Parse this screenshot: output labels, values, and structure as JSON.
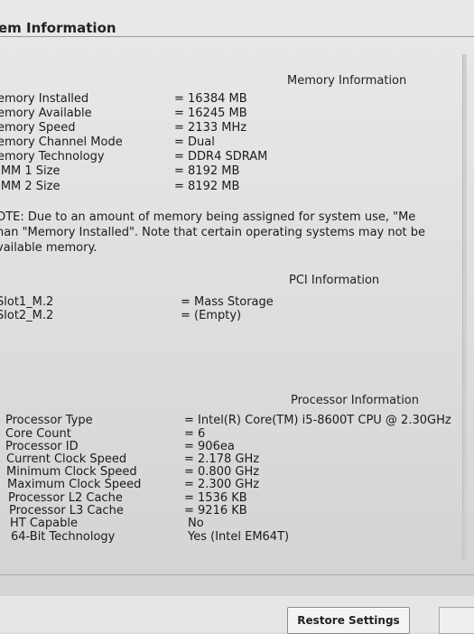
{
  "section_title": "em Information",
  "memory": {
    "header": "Memory Information",
    "rows": [
      {
        "label": "emory Installed",
        "value": "= 16384 MB"
      },
      {
        "label": "emory Available",
        "value": "= 16245 MB"
      },
      {
        "label": "emory Speed",
        "value": "= 2133 MHz"
      },
      {
        "label": "emory Channel Mode",
        "value": "= Dual"
      },
      {
        "label": "emory Technology",
        "value": "= DDR4 SDRAM"
      },
      {
        "label": "IMM 1 Size",
        "value": "= 8192 MB"
      },
      {
        "label": "IMM 2 Size",
        "value": "= 8192 MB"
      }
    ],
    "note_lines": [
      "OTE: Due to an amount of memory being assigned for system use, \"Me",
      "han \"Memory Installed\". Note that certain operating systems may not be",
      "vailable memory."
    ]
  },
  "pci": {
    "header": "PCI Information",
    "rows": [
      {
        "label": "Slot1_M.2",
        "value": "= Mass Storage"
      },
      {
        "label": "Slot2_M.2",
        "value": "= (Empty)"
      }
    ]
  },
  "processor": {
    "header": "Processor Information",
    "rows": [
      {
        "label": "Processor Type",
        "value": "= Intel(R) Core(TM) i5-8600T CPU @ 2.30GHz"
      },
      {
        "label": "Core Count",
        "value": "= 6"
      },
      {
        "label": "Processor ID",
        "value": "= 906ea"
      },
      {
        "label": "Current Clock Speed",
        "value": "= 2.178 GHz"
      },
      {
        "label": "Minimum Clock Speed",
        "value": "= 0.800 GHz"
      },
      {
        "label": "Maximum Clock Speed",
        "value": "= 2.300 GHz"
      },
      {
        "label": "Processor L2 Cache",
        "value": "= 1536 KB"
      },
      {
        "label": "Processor L3 Cache",
        "value": "= 9216 KB"
      },
      {
        "label": "HT Capable",
        "value": "No"
      },
      {
        "label": "64-Bit Technology",
        "value": "Yes (Intel EM64T)"
      }
    ]
  },
  "footer": {
    "restore_label": "Restore Settings"
  }
}
